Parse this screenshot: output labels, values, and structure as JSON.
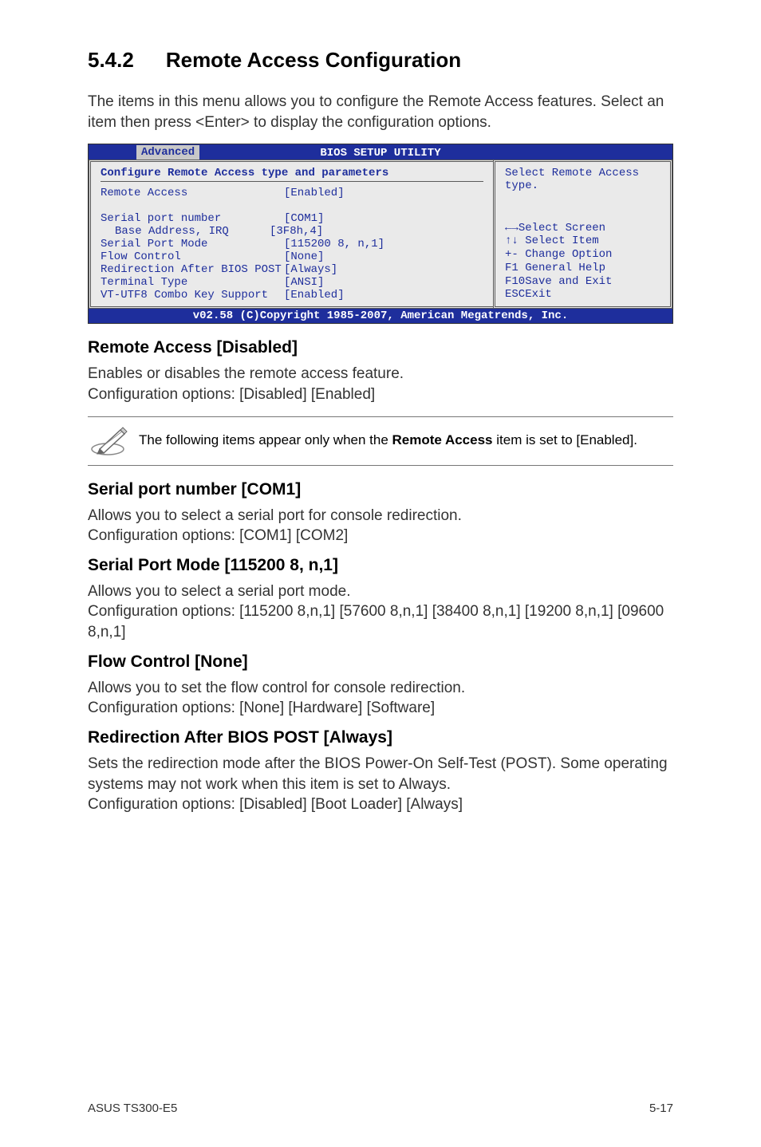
{
  "heading": {
    "number": "5.4.2",
    "title": "Remote Access Configuration"
  },
  "intro": "The items in this menu allows you to configure the Remote Access features. Select an item then press <Enter> to display the configuration options.",
  "bios": {
    "title": "BIOS SETUP UTILITY",
    "tab": "Advanced",
    "config_heading": "Configure Remote Access type and parameters",
    "remote_access_label": "Remote Access",
    "remote_access_value": "[Enabled]",
    "rows": [
      {
        "label": "Serial port number",
        "value": "[COM1]",
        "indent": false
      },
      {
        "label": "Base Address, IRQ",
        "value": "[3F8h,4]",
        "indent": true
      },
      {
        "label": "Serial Port Mode",
        "value": "[115200 8, n,1]",
        "indent": false
      },
      {
        "label": "Flow Control",
        "value": "[None]",
        "indent": false
      },
      {
        "label": "Redirection After BIOS POST",
        "value": "[Always]",
        "indent": false
      },
      {
        "label": "Terminal Type",
        "value": "[ANSI]",
        "indent": false
      },
      {
        "label": "VT-UTF8 Combo Key Support",
        "value": "[Enabled]",
        "indent": false
      }
    ],
    "help_top": "Select Remote Access type.",
    "help_bottom": {
      "l1a": "←→",
      "l1b": "Select Screen",
      "l2a": "↑↓",
      "l2b": " Select Item",
      "l3": "+- Change Option",
      "l4": "F1 General Help",
      "l5": "F10Save and Exit",
      "l6": "ESCExit"
    },
    "footer": "v02.58 (C)Copyright 1985-2007, American Megatrends, Inc."
  },
  "sections": [
    {
      "title": "Remote Access [Disabled]",
      "body": "Enables or disables the remote access feature.\nConfiguration options: [Disabled] [Enabled]"
    }
  ],
  "note": {
    "prefix": "The following items appear only when the ",
    "bold": "Remote Access",
    "suffix": " item is set to [Enabled]."
  },
  "sections2": [
    {
      "title": "Serial port number [COM1]",
      "body": "Allows you to select a serial port for console redirection.\nConfiguration options: [COM1] [COM2]"
    },
    {
      "title": "Serial Port Mode [115200 8, n,1]",
      "body": "Allows you to select a serial port mode.\nConfiguration options: [115200 8,n,1] [57600 8,n,1] [38400 8,n,1] [19200 8,n,1] [09600 8,n,1]"
    },
    {
      "title": "Flow Control [None]",
      "body": "Allows you to set the flow control for console redirection.\nConfiguration options: [None] [Hardware] [Software]"
    },
    {
      "title": "Redirection After BIOS POST [Always]",
      "body": "Sets the redirection mode after the BIOS Power-On Self-Test (POST). Some operating systems may not work when this item is set to Always.\nConfiguration options: [Disabled] [Boot Loader] [Always]"
    }
  ],
  "footer": {
    "left": "ASUS TS300-E5",
    "right": "5-17"
  }
}
